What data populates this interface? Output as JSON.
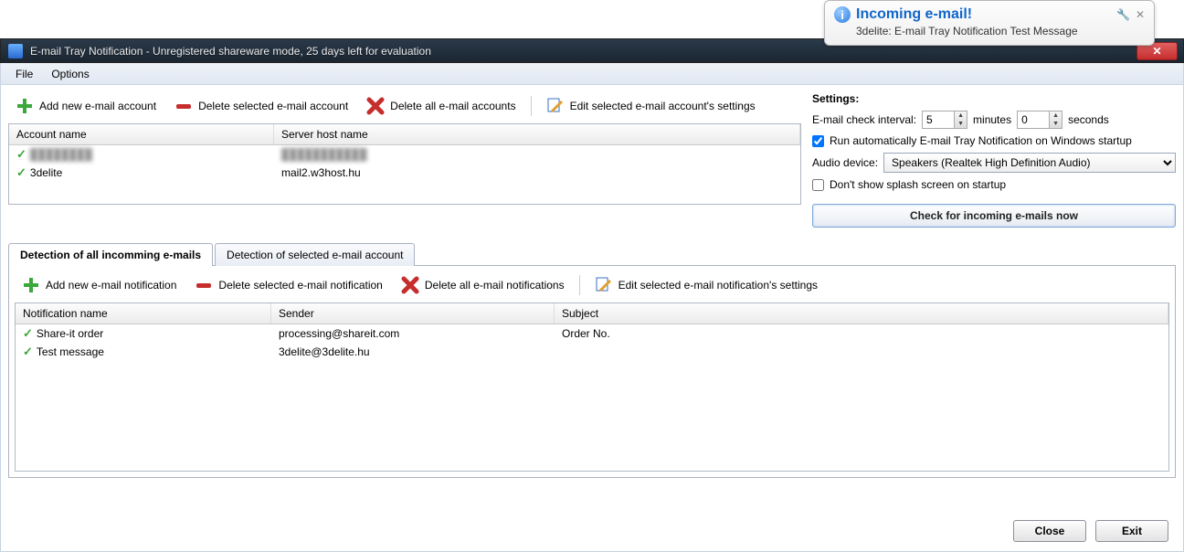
{
  "popup": {
    "title": "Incoming e-mail!",
    "subtitle": "3delite: E-mail Tray Notification Test Message"
  },
  "window": {
    "title": "E-mail Tray Notification - Unregistered shareware mode, 25 days left for evaluation"
  },
  "menu": {
    "file": "File",
    "options": "Options"
  },
  "toolbar_accounts": {
    "add": "Add new e-mail account",
    "delete_selected": "Delete selected e-mail account",
    "delete_all": "Delete all e-mail accounts",
    "edit": "Edit selected e-mail account's settings"
  },
  "accounts_table": {
    "col_name": "Account name",
    "col_host": "Server host name",
    "rows": [
      {
        "name": "████████",
        "host": "███████████",
        "blurred": true
      },
      {
        "name": "3delite",
        "host": "mail2.w3host.hu",
        "blurred": false
      }
    ]
  },
  "settings": {
    "title": "Settings:",
    "interval_label": "E-mail check interval:",
    "minutes_value": "5",
    "minutes_label": "minutes",
    "seconds_value": "0",
    "seconds_label": "seconds",
    "autostart_checked": true,
    "autostart_label": "Run automatically E-mail Tray Notification on Windows startup",
    "audio_label": "Audio device:",
    "audio_value": "Speakers (Realtek High Definition Audio)",
    "splash_checked": false,
    "splash_label": "Don't show splash screen on startup",
    "check_now": "Check for incoming e-mails now"
  },
  "tabs": {
    "all": "Detection of all incomming e-mails",
    "selected": "Detection of selected e-mail account"
  },
  "toolbar_notifications": {
    "add": "Add new e-mail notification",
    "delete_selected": "Delete selected e-mail notification",
    "delete_all": "Delete all e-mail notifications",
    "edit": "Edit selected e-mail notification's settings"
  },
  "notifications_table": {
    "col_name": "Notification name",
    "col_sender": "Sender",
    "col_subject": "Subject",
    "rows": [
      {
        "name": "Share-it order",
        "sender": "processing@shareit.com",
        "subject": "Order No."
      },
      {
        "name": "Test message",
        "sender": "3delite@3delite.hu",
        "subject": ""
      }
    ]
  },
  "footer": {
    "close": "Close",
    "exit": "Exit"
  }
}
